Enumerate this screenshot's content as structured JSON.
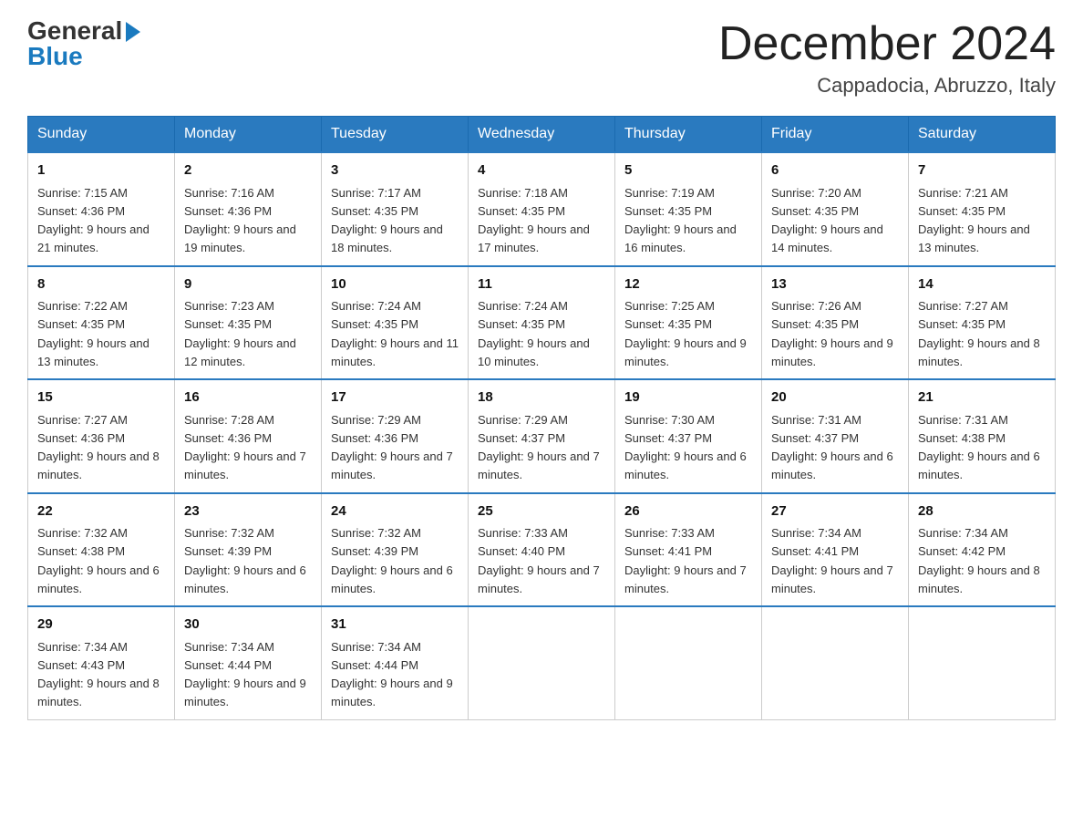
{
  "logo": {
    "general": "General",
    "blue": "Blue"
  },
  "header": {
    "month": "December 2024",
    "location": "Cappadocia, Abruzzo, Italy"
  },
  "days": [
    "Sunday",
    "Monday",
    "Tuesday",
    "Wednesday",
    "Thursday",
    "Friday",
    "Saturday"
  ],
  "weeks": [
    [
      {
        "num": "1",
        "sunrise": "7:15 AM",
        "sunset": "4:36 PM",
        "daylight": "9 hours and 21 minutes."
      },
      {
        "num": "2",
        "sunrise": "7:16 AM",
        "sunset": "4:36 PM",
        "daylight": "9 hours and 19 minutes."
      },
      {
        "num": "3",
        "sunrise": "7:17 AM",
        "sunset": "4:35 PM",
        "daylight": "9 hours and 18 minutes."
      },
      {
        "num": "4",
        "sunrise": "7:18 AM",
        "sunset": "4:35 PM",
        "daylight": "9 hours and 17 minutes."
      },
      {
        "num": "5",
        "sunrise": "7:19 AM",
        "sunset": "4:35 PM",
        "daylight": "9 hours and 16 minutes."
      },
      {
        "num": "6",
        "sunrise": "7:20 AM",
        "sunset": "4:35 PM",
        "daylight": "9 hours and 14 minutes."
      },
      {
        "num": "7",
        "sunrise": "7:21 AM",
        "sunset": "4:35 PM",
        "daylight": "9 hours and 13 minutes."
      }
    ],
    [
      {
        "num": "8",
        "sunrise": "7:22 AM",
        "sunset": "4:35 PM",
        "daylight": "9 hours and 13 minutes."
      },
      {
        "num": "9",
        "sunrise": "7:23 AM",
        "sunset": "4:35 PM",
        "daylight": "9 hours and 12 minutes."
      },
      {
        "num": "10",
        "sunrise": "7:24 AM",
        "sunset": "4:35 PM",
        "daylight": "9 hours and 11 minutes."
      },
      {
        "num": "11",
        "sunrise": "7:24 AM",
        "sunset": "4:35 PM",
        "daylight": "9 hours and 10 minutes."
      },
      {
        "num": "12",
        "sunrise": "7:25 AM",
        "sunset": "4:35 PM",
        "daylight": "9 hours and 9 minutes."
      },
      {
        "num": "13",
        "sunrise": "7:26 AM",
        "sunset": "4:35 PM",
        "daylight": "9 hours and 9 minutes."
      },
      {
        "num": "14",
        "sunrise": "7:27 AM",
        "sunset": "4:35 PM",
        "daylight": "9 hours and 8 minutes."
      }
    ],
    [
      {
        "num": "15",
        "sunrise": "7:27 AM",
        "sunset": "4:36 PM",
        "daylight": "9 hours and 8 minutes."
      },
      {
        "num": "16",
        "sunrise": "7:28 AM",
        "sunset": "4:36 PM",
        "daylight": "9 hours and 7 minutes."
      },
      {
        "num": "17",
        "sunrise": "7:29 AM",
        "sunset": "4:36 PM",
        "daylight": "9 hours and 7 minutes."
      },
      {
        "num": "18",
        "sunrise": "7:29 AM",
        "sunset": "4:37 PM",
        "daylight": "9 hours and 7 minutes."
      },
      {
        "num": "19",
        "sunrise": "7:30 AM",
        "sunset": "4:37 PM",
        "daylight": "9 hours and 6 minutes."
      },
      {
        "num": "20",
        "sunrise": "7:31 AM",
        "sunset": "4:37 PM",
        "daylight": "9 hours and 6 minutes."
      },
      {
        "num": "21",
        "sunrise": "7:31 AM",
        "sunset": "4:38 PM",
        "daylight": "9 hours and 6 minutes."
      }
    ],
    [
      {
        "num": "22",
        "sunrise": "7:32 AM",
        "sunset": "4:38 PM",
        "daylight": "9 hours and 6 minutes."
      },
      {
        "num": "23",
        "sunrise": "7:32 AM",
        "sunset": "4:39 PM",
        "daylight": "9 hours and 6 minutes."
      },
      {
        "num": "24",
        "sunrise": "7:32 AM",
        "sunset": "4:39 PM",
        "daylight": "9 hours and 6 minutes."
      },
      {
        "num": "25",
        "sunrise": "7:33 AM",
        "sunset": "4:40 PM",
        "daylight": "9 hours and 7 minutes."
      },
      {
        "num": "26",
        "sunrise": "7:33 AM",
        "sunset": "4:41 PM",
        "daylight": "9 hours and 7 minutes."
      },
      {
        "num": "27",
        "sunrise": "7:34 AM",
        "sunset": "4:41 PM",
        "daylight": "9 hours and 7 minutes."
      },
      {
        "num": "28",
        "sunrise": "7:34 AM",
        "sunset": "4:42 PM",
        "daylight": "9 hours and 8 minutes."
      }
    ],
    [
      {
        "num": "29",
        "sunrise": "7:34 AM",
        "sunset": "4:43 PM",
        "daylight": "9 hours and 8 minutes."
      },
      {
        "num": "30",
        "sunrise": "7:34 AM",
        "sunset": "4:44 PM",
        "daylight": "9 hours and 9 minutes."
      },
      {
        "num": "31",
        "sunrise": "7:34 AM",
        "sunset": "4:44 PM",
        "daylight": "9 hours and 9 minutes."
      },
      null,
      null,
      null,
      null
    ]
  ]
}
